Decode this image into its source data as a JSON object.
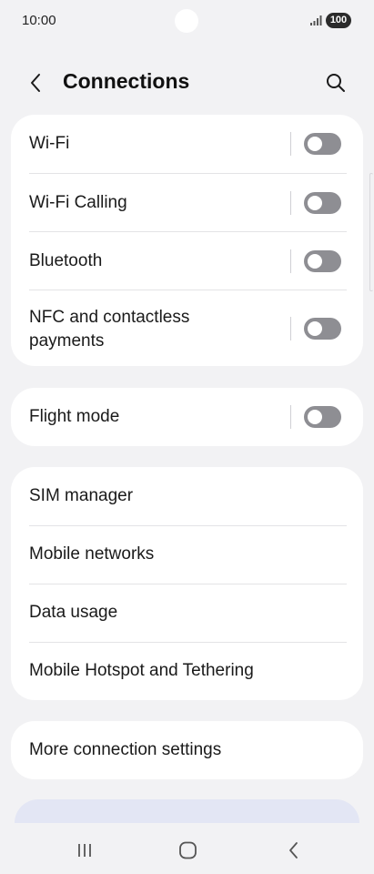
{
  "status_bar": {
    "time": "10:00",
    "battery": "100",
    "icons": [
      "signal-icon",
      "battery-icon"
    ]
  },
  "header": {
    "title": "Connections",
    "icons": [
      "chevron-left-icon",
      "search-icon"
    ]
  },
  "groups": [
    {
      "items": [
        {
          "label": "Wi-Fi",
          "toggle": "off"
        },
        {
          "label": "Wi-Fi Calling",
          "toggle": "off"
        },
        {
          "label": "Bluetooth",
          "toggle": "off"
        },
        {
          "label_line1": "NFC and contactless",
          "label_line2": "payments",
          "toggle": "off"
        }
      ]
    },
    {
      "items": [
        {
          "label": "Flight mode",
          "toggle": "off"
        }
      ]
    },
    {
      "items": [
        {
          "label": "SIM manager"
        },
        {
          "label": "Mobile networks"
        },
        {
          "label": "Data usage"
        },
        {
          "label": "Mobile Hotspot and Tethering"
        }
      ]
    },
    {
      "items": [
        {
          "label": "More connection settings"
        }
      ]
    }
  ],
  "nav_bar": {
    "icons": [
      "recent-apps-icon",
      "home-icon",
      "back-icon"
    ]
  },
  "colors": {
    "background": "#f2f2f4",
    "card": "#ffffff",
    "toggle_off": "#8e8e93",
    "peek_card": "#e3e6f4"
  }
}
